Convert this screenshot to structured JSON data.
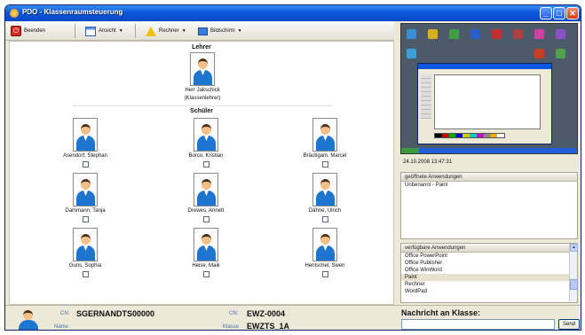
{
  "window": {
    "title": "PDO - Klassenraumsteuerung",
    "minimize_glyph": "_",
    "maximize_glyph": "□",
    "close_glyph": "✕"
  },
  "toolbar": {
    "quit_label": "Beenden",
    "view_label": "Ansicht",
    "computer_label": "Rechner",
    "screen_label": "Bildschirm",
    "dropdown_glyph": "▼"
  },
  "classroom": {
    "teacher_section": "Lehrer",
    "teacher": {
      "name": "Herr Jakschick",
      "role": "(Klassenlehrer)"
    },
    "students_section": "Schüler",
    "students": [
      {
        "name": "Asendorf, Stephan"
      },
      {
        "name": "Borco, Kristian"
      },
      {
        "name": "Bräutigam, Marcel"
      },
      {
        "name": "Dammann, Tanja"
      },
      {
        "name": "Drewes, Annett"
      },
      {
        "name": "Dähne, Ulrich"
      },
      {
        "name": "Guns, Sophia"
      },
      {
        "name": "Heise, Maik"
      },
      {
        "name": "Hentschel, Swen"
      }
    ]
  },
  "preview": {
    "timestamp": "24.10.2008 13:47:31"
  },
  "open_apps": {
    "header": "geöffnete Anwendungen",
    "items": [
      "Unbenannt - Paint"
    ]
  },
  "available_apps": {
    "header": "verfügbare Anwendungen",
    "items": [
      "Office PowerPoint",
      "Office Publisher",
      "Office WinWord",
      "Paint",
      "Rechner",
      "WordPad"
    ],
    "selected": "Paint"
  },
  "status": {
    "cn_label": "CN:",
    "cn_value": "SGERNANDTS00000",
    "name_label": "Name",
    "cn2_label": "CN:",
    "cn2_value": "EWZ-0004",
    "class_label": "Klasse",
    "class_value": "EWZTS_1A",
    "message_label": "Nachricht an Klasse:",
    "message_value": "",
    "send_label": "Send"
  },
  "colors": {
    "titlebar": "#0a58e0",
    "avatar_shirt": "#1d75cf",
    "panel_bg": "#ece9d8"
  }
}
